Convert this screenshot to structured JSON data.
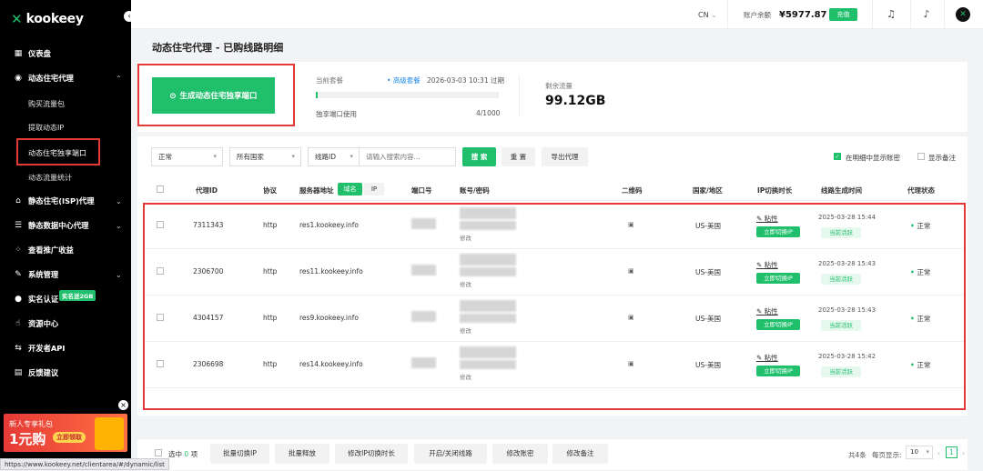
{
  "brand": {
    "name": "kookeey"
  },
  "sidebar": {
    "items": [
      {
        "label": "仪表盘",
        "icon": "dashboard-icon"
      },
      {
        "label": "动态住宅代理",
        "icon": "globe-icon",
        "expanded": true,
        "children": [
          "购买流量包",
          "提取动态IP",
          "动态住宅独享端口",
          "动态流量统计"
        ]
      },
      {
        "label": "静态住宅(ISP)代理",
        "icon": "home-icon"
      },
      {
        "label": "静态数据中心代理",
        "icon": "server-icon"
      },
      {
        "label": "查看推广收益",
        "icon": "share-icon"
      },
      {
        "label": "系统管理",
        "icon": "edit-icon"
      },
      {
        "label": "实名认证",
        "icon": "user-icon",
        "badge": "实名送2GB"
      },
      {
        "label": "资源中心",
        "icon": "hand-icon"
      },
      {
        "label": "开发者API",
        "icon": "api-icon"
      },
      {
        "label": "反馈建议",
        "icon": "feedback-icon"
      }
    ],
    "promo": {
      "line1": "新人专享礼包",
      "line2": "1元购",
      "button": "立即领取"
    }
  },
  "topbar": {
    "language": "CN",
    "balance_label": "账户余额",
    "balance": "¥5977.87",
    "recharge": "充值"
  },
  "page": {
    "title": "动态住宅代理 - 已购线路明细"
  },
  "package": {
    "generate_button": "生成动态住宅独享端口",
    "current_label": "当前套餐",
    "tier": "高级套餐",
    "expiry": "2026-03-03 10:31 过期",
    "port_usage_label": "独享端口使用",
    "port_usage": "4/1000",
    "port_usage_fraction": 0.004,
    "remaining_label": "剩余流量",
    "remaining": "99.12GB"
  },
  "filters": {
    "status": "正常",
    "country": "所有国家",
    "field": "线路ID",
    "search_placeholder": "请输入搜索内容...",
    "search_button": "搜 索",
    "reset_button": "重 置",
    "export_button": "导出代理",
    "show_account_label": "在明细中显示账密",
    "show_account_checked": true,
    "show_note_label": "显示备注",
    "show_note_checked": false
  },
  "table": {
    "headers": {
      "id": "代理ID",
      "protocol": "协议",
      "server": "服务器地址",
      "domain_tab": "域名",
      "ip_tab": "IP",
      "port": "端口号",
      "account": "账号/密码",
      "qrcode": "二维码",
      "region": "国家/地区",
      "ip_switch": "IP切换时长",
      "created": "线路生成时间",
      "status": "代理状态"
    },
    "row_labels": {
      "modify": "修改",
      "sticky": "粘性",
      "switch_now": "立即切换IP",
      "active": "当前活跃"
    },
    "rows": [
      {
        "id": "7311343",
        "protocol": "http",
        "server": "res1.kookeey.info",
        "region": "US-美国",
        "created": "2025-03-28 15:44",
        "status": "正常"
      },
      {
        "id": "2306700",
        "protocol": "http",
        "server": "res11.kookeey.info",
        "region": "US-美国",
        "created": "2025-03-28 15:43",
        "status": "正常"
      },
      {
        "id": "4304157",
        "protocol": "http",
        "server": "res9.kookeey.info",
        "region": "US-美国",
        "created": "2025-03-28 15:43",
        "status": "正常"
      },
      {
        "id": "2306698",
        "protocol": "http",
        "server": "res14.kookeey.info",
        "region": "US-美国",
        "created": "2025-03-28 15:42",
        "status": "正常"
      }
    ]
  },
  "bottom": {
    "selected_prefix": "选中",
    "selected_count": "0",
    "selected_suffix": "项",
    "actions": [
      "批量切换IP",
      "批量释放",
      "修改IP切换时长",
      "开启/关闭线路",
      "修改账密",
      "修改备注"
    ],
    "total": "共4条",
    "page_size_label": "每页显示:",
    "page_size": "10",
    "current_page": "1"
  },
  "status_url": "https://www.kookeey.net/clientarea/#/dynamic/list"
}
